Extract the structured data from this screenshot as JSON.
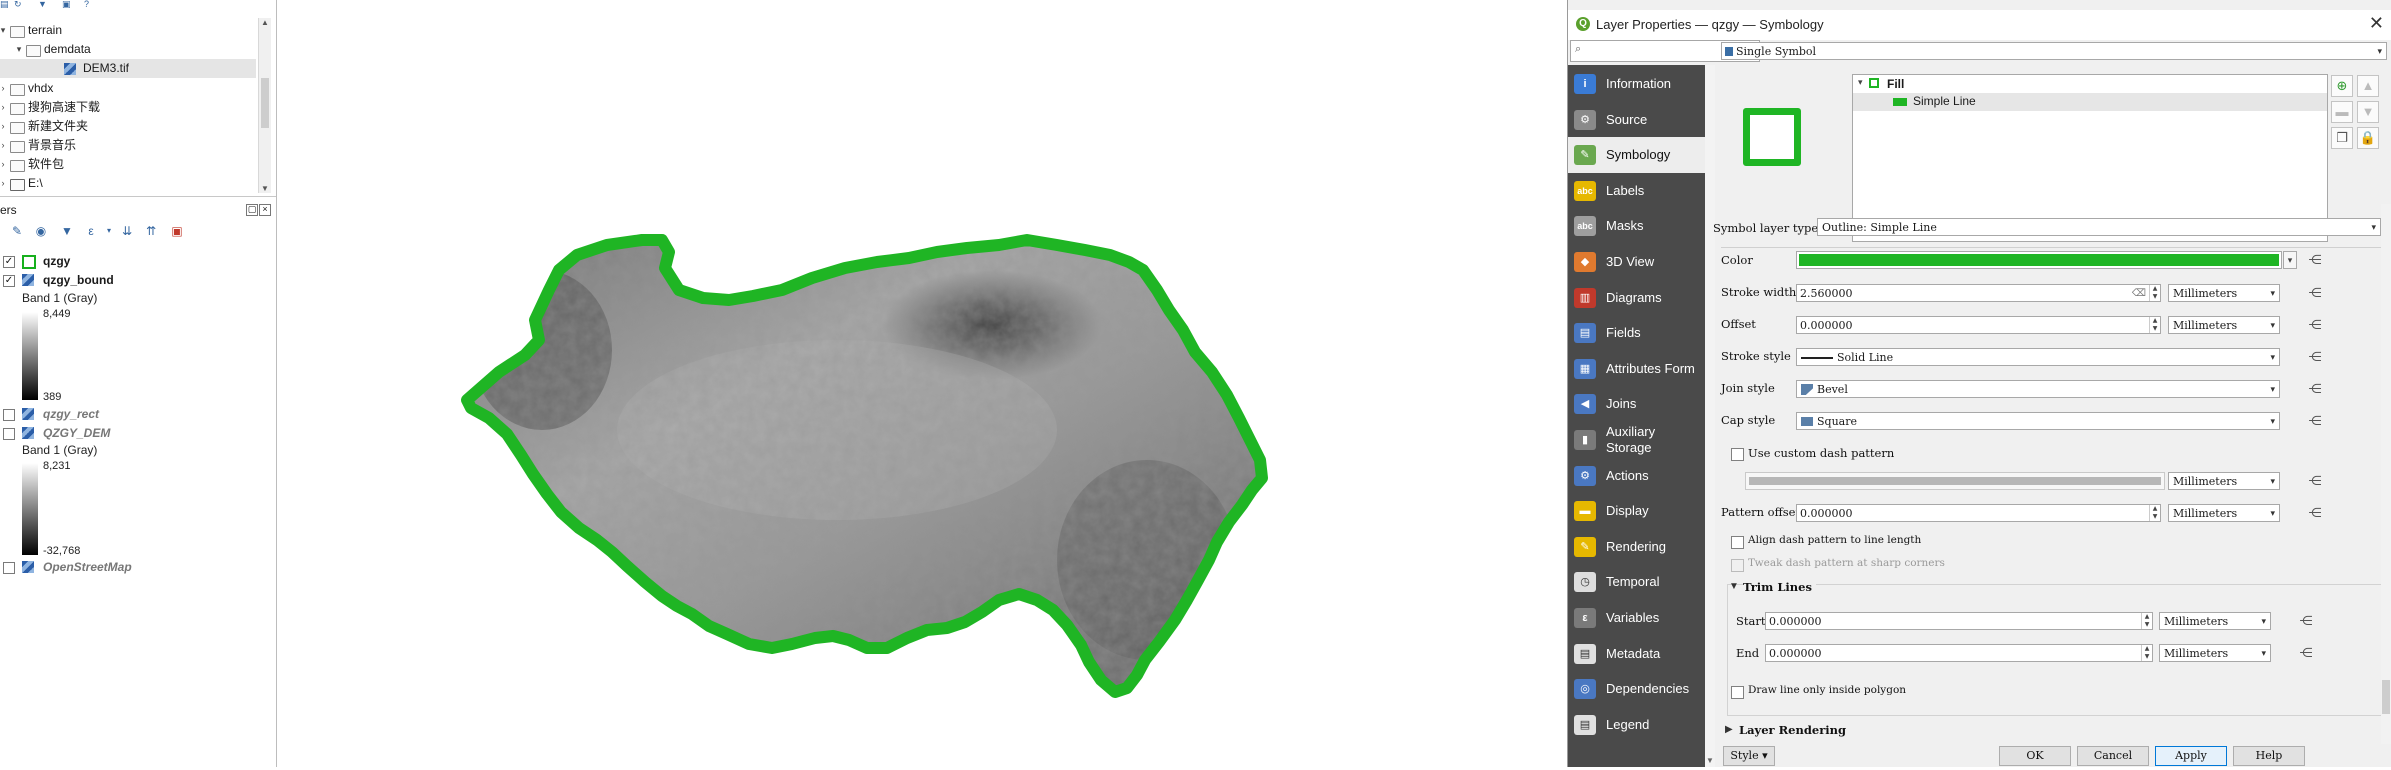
{
  "browser": {
    "items": [
      {
        "label": "terrain",
        "indent": 0,
        "kind": "folder",
        "arrow": "▾"
      },
      {
        "label": "demdata",
        "indent": 1,
        "kind": "folder",
        "arrow": "▾"
      },
      {
        "label": "DEM3.tif",
        "indent": 2,
        "kind": "raster",
        "arrow": ""
      },
      {
        "label": "vhdx",
        "indent": 0,
        "kind": "folder",
        "arrow": "›"
      },
      {
        "label": "搜狗高速下载",
        "indent": 0,
        "kind": "folder",
        "arrow": "›"
      },
      {
        "label": "新建文件夹",
        "indent": 0,
        "kind": "folder",
        "arrow": "›"
      },
      {
        "label": "背景音乐",
        "indent": 0,
        "kind": "folder",
        "arrow": "›"
      },
      {
        "label": "软件包",
        "indent": 0,
        "kind": "folder",
        "arrow": "›"
      },
      {
        "label": "E:\\",
        "indent": 0,
        "kind": "drive",
        "arrow": "›"
      }
    ]
  },
  "layers_panel": {
    "title": "ers",
    "layers": [
      {
        "name": "qzgy",
        "checked": true,
        "bold": true,
        "italic": false,
        "symbol": "fill"
      },
      {
        "name": "qzgy_bound",
        "checked": true,
        "bold": true,
        "italic": false,
        "symbol": "raster"
      },
      {
        "name": "qzgy_rect",
        "checked": false,
        "bold": true,
        "italic": true,
        "symbol": "raster"
      },
      {
        "name": "QZGY_DEM",
        "checked": false,
        "bold": true,
        "italic": true,
        "symbol": "raster"
      },
      {
        "name": "OpenStreetMap",
        "checked": false,
        "bold": true,
        "italic": true,
        "symbol": "raster"
      }
    ],
    "legend1": {
      "band": "Band 1 (Gray)",
      "max": "8,449",
      "min": "389"
    },
    "legend2": {
      "band": "Band 1 (Gray)",
      "max": "8,231",
      "min": "-32,768"
    }
  },
  "dialog": {
    "title": "Layer Properties — qzgy — Symbology",
    "search_placeholder": "",
    "nav": [
      {
        "label": "Information",
        "icon": "information-icon",
        "glyph": "i",
        "color": "#3a7bd5"
      },
      {
        "label": "Source",
        "icon": "source-icon",
        "glyph": "⚙",
        "color": "#8a8a8a"
      },
      {
        "label": "Symbology",
        "icon": "symbology-icon",
        "glyph": "✎",
        "color": "#6aa84f",
        "active": true
      },
      {
        "label": "Labels",
        "icon": "labels-icon",
        "glyph": "abc",
        "color": "#e6b800"
      },
      {
        "label": "Masks",
        "icon": "masks-icon",
        "glyph": "abc",
        "color": "#9e9e9e"
      },
      {
        "label": "3D View",
        "icon": "3d-view-icon",
        "glyph": "◆",
        "color": "#e07a2f"
      },
      {
        "label": "Diagrams",
        "icon": "diagrams-icon",
        "glyph": "▥",
        "color": "#c0392b"
      },
      {
        "label": "Fields",
        "icon": "fields-icon",
        "glyph": "▤",
        "color": "#4a78c2"
      },
      {
        "label": "Attributes Form",
        "icon": "attributes-form-icon",
        "glyph": "▦",
        "color": "#4a78c2"
      },
      {
        "label": "Joins",
        "icon": "joins-icon",
        "glyph": "◀",
        "color": "#4a78c2"
      },
      {
        "label": "Auxiliary Storage",
        "icon": "auxiliary-storage-icon",
        "glyph": "▮",
        "color": "#7a7a7a"
      },
      {
        "label": "Actions",
        "icon": "actions-icon",
        "glyph": "⚙",
        "color": "#4a78c2"
      },
      {
        "label": "Display",
        "icon": "display-icon",
        "glyph": "▬",
        "color": "#e6b800"
      },
      {
        "label": "Rendering",
        "icon": "rendering-icon",
        "glyph": "✎",
        "color": "#e6b800"
      },
      {
        "label": "Temporal",
        "icon": "temporal-icon",
        "glyph": "◷",
        "color": "#dddddd"
      },
      {
        "label": "Variables",
        "icon": "variables-icon",
        "glyph": "ε",
        "color": "#7a7a7a"
      },
      {
        "label": "Metadata",
        "icon": "metadata-icon",
        "glyph": "▤",
        "color": "#e0e0e0"
      },
      {
        "label": "Dependencies",
        "icon": "dependencies-icon",
        "glyph": "◎",
        "color": "#4a78c2"
      },
      {
        "label": "Legend",
        "icon": "legend-icon",
        "glyph": "▤",
        "color": "#e0e0e0"
      }
    ],
    "renderer": "Single Symbol",
    "symbol_tree": {
      "fill": "Fill",
      "line": "Simple Line"
    },
    "symbol_layer_type_label": "Symbol layer type",
    "symbol_layer_type": "Outline: Simple Line",
    "color_label": "Color",
    "color_value": "#1fb524",
    "stroke_width_label": "Stroke width",
    "stroke_width": "2.560000",
    "offset_label": "Offset",
    "offset": "0.000000",
    "stroke_style_label": "Stroke style",
    "stroke_style": "Solid Line",
    "join_style_label": "Join style",
    "join_style": "Bevel",
    "cap_style_label": "Cap style",
    "cap_style": "Square",
    "custom_dash_label": "Use custom dash pattern",
    "pattern_offset_label": "Pattern offset",
    "pattern_offset": "0.000000",
    "align_dash_label": "Align dash pattern to line length",
    "tweak_dash_label": "Tweak dash pattern at sharp corners",
    "trim_lines_label": "Trim Lines",
    "start_label": "Start",
    "start": "0.000000",
    "end_label": "End",
    "end": "0.000000",
    "draw_inside_label": "Draw line only inside polygon",
    "layer_rendering_label": "Layer Rendering",
    "unit": "Millimeters",
    "buttons": {
      "style": "Style",
      "ok": "OK",
      "cancel": "Cancel",
      "apply": "Apply",
      "help": "Help"
    }
  },
  "colors": {
    "outline": "#1fb524",
    "nav_bg": "#4a4a4a"
  }
}
